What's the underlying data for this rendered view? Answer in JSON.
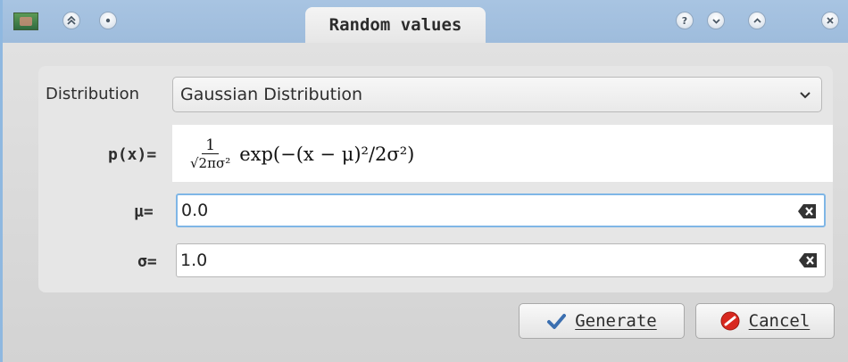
{
  "window": {
    "title": "Random values",
    "colors": {
      "titlebar": "#a8c4e2",
      "focus": "#7fb6e6"
    }
  },
  "titlebar": {
    "left_buttons": [
      "app-icon",
      "keep-above-icon",
      "on-all-desktops-icon"
    ],
    "right_buttons": [
      "help-icon",
      "minimize-icon",
      "maximize-icon",
      "close-icon"
    ]
  },
  "form": {
    "distribution_label": "Distribution",
    "distribution_value": "Gaussian Distribution",
    "formula_label": "p(x)=",
    "formula": {
      "numerator": "1",
      "denominator": "√2πσ²",
      "expression": "exp(−(x − μ)²/2σ²)"
    },
    "mu_label": "μ=",
    "mu_value": "0.0",
    "sigma_label": "σ=",
    "sigma_value": "1.0"
  },
  "buttons": {
    "generate": "Generate",
    "cancel": "Cancel"
  }
}
